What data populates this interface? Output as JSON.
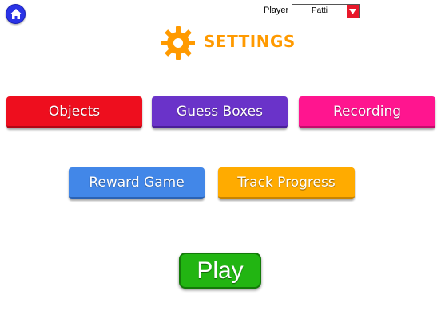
{
  "header": {
    "home_icon": "home-icon",
    "player_label": "Player",
    "player_value": "Patti",
    "title": "SETTINGS",
    "title_icon": "gear-icon",
    "title_color": "#ff9a00"
  },
  "buttons": {
    "objects": "Objects",
    "guess_boxes": "Guess Boxes",
    "recording": "Recording",
    "reward_game": "Reward Game",
    "track_progress": "Track Progress",
    "play": "Play"
  },
  "colors": {
    "objects": "#ee0e1e",
    "guess_boxes": "#6a33c9",
    "recording": "#ff158f",
    "reward_game": "#4287e8",
    "track_progress": "#ffab00",
    "play": "#22b512",
    "home": "#2a33e6"
  }
}
